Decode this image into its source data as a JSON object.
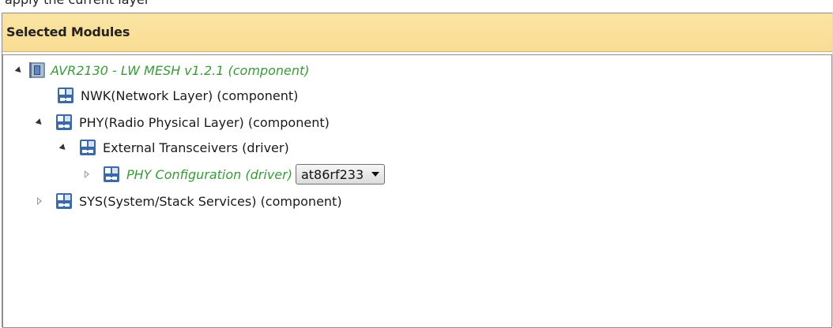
{
  "top_strip": {
    "text": "apply the current layer"
  },
  "panel": {
    "title": "Selected Modules"
  },
  "tree": [
    {
      "label": "AVR2130 - LW MESH v1.2.1 (component)",
      "style": "green-italic",
      "expanded": true,
      "icon": "board-chip-icon"
    },
    {
      "label": "NWK(Network Layer)  (component)",
      "style": "normal",
      "expanded": null,
      "icon": "module-icon"
    },
    {
      "label": "PHY(Radio Physical Layer) (component)",
      "style": "normal",
      "expanded": true,
      "icon": "module-icon"
    },
    {
      "label": "External Transceivers (driver)",
      "style": "normal",
      "expanded": true,
      "icon": "module-icon"
    },
    {
      "label": "PHY Configuration (driver)",
      "style": "green-italic",
      "expanded": false,
      "icon": "module-icon",
      "select": {
        "value": "at86rf233"
      }
    },
    {
      "label": "SYS(System/Stack Services) (component)",
      "style": "normal",
      "expanded": false,
      "icon": "module-icon"
    }
  ],
  "colors": {
    "header_bg": "#f9dd97",
    "green_text": "#3a9a3a",
    "icon_blue": "#3c6aa6"
  }
}
